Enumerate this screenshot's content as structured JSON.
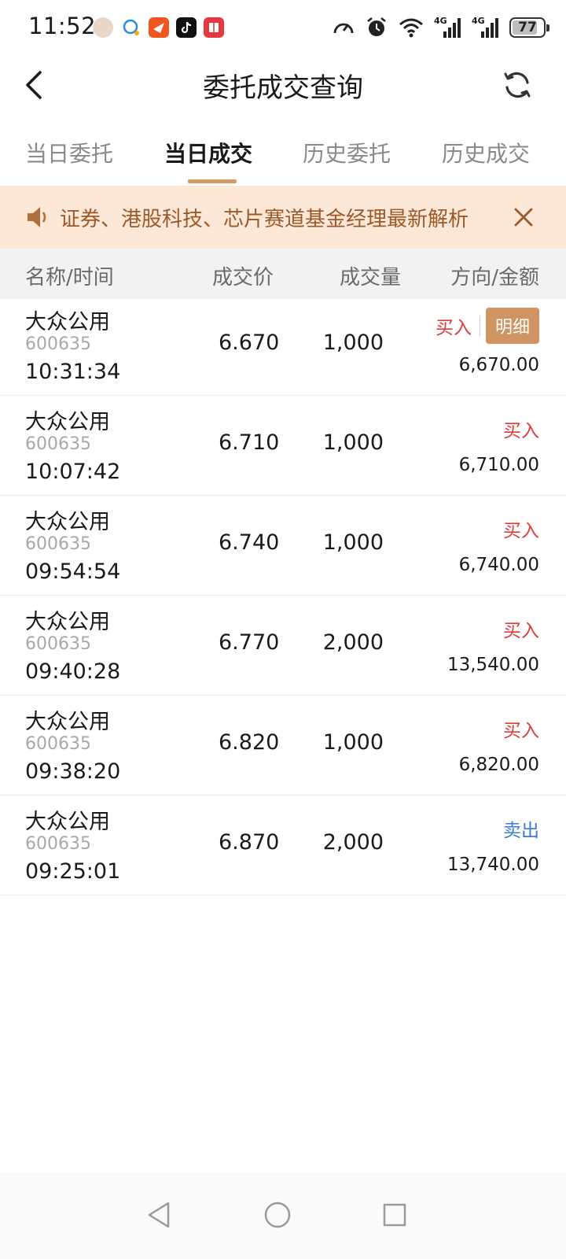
{
  "status_bar": {
    "time": "11:52",
    "battery": "77",
    "network_1": "4G",
    "network_2": "4G"
  },
  "header": {
    "title": "委托成交查询"
  },
  "tabs": [
    {
      "label": "当日委托"
    },
    {
      "label": "当日成交"
    },
    {
      "label": "历史委托"
    },
    {
      "label": "历史成交"
    }
  ],
  "notice": {
    "text": "证券、港股科技、芯片赛道基金经理最新解析"
  },
  "table": {
    "headers": {
      "name_time": "名称/时间",
      "price": "成交价",
      "qty": "成交量",
      "dir_amount": "方向/金额"
    },
    "detail_label": "明细",
    "rows": [
      {
        "name": "大众公用",
        "code": "600635",
        "time": "10:31:34",
        "price": "6.670",
        "qty": "1,000",
        "direction": "买入",
        "amount": "6,670.00"
      },
      {
        "name": "大众公用",
        "code": "600635",
        "time": "10:07:42",
        "price": "6.710",
        "qty": "1,000",
        "direction": "买入",
        "amount": "6,710.00"
      },
      {
        "name": "大众公用",
        "code": "600635",
        "time": "09:54:54",
        "price": "6.740",
        "qty": "1,000",
        "direction": "买入",
        "amount": "6,740.00"
      },
      {
        "name": "大众公用",
        "code": "600635",
        "time": "09:40:28",
        "price": "6.770",
        "qty": "2,000",
        "direction": "买入",
        "amount": "13,540.00"
      },
      {
        "name": "大众公用",
        "code": "600635",
        "time": "09:38:20",
        "price": "6.820",
        "qty": "1,000",
        "direction": "买入",
        "amount": "6,820.00"
      },
      {
        "name": "大众公用",
        "code": "600635",
        "time": "09:25:01",
        "price": "6.870",
        "qty": "2,000",
        "direction": "卖出",
        "amount": "13,740.00"
      }
    ]
  },
  "colors": {
    "accent": "#d59a66",
    "buy": "#e03b3b",
    "sell": "#3b78d8",
    "notice_bg": "#fde7d6",
    "notice_text": "#9a5a2a"
  }
}
